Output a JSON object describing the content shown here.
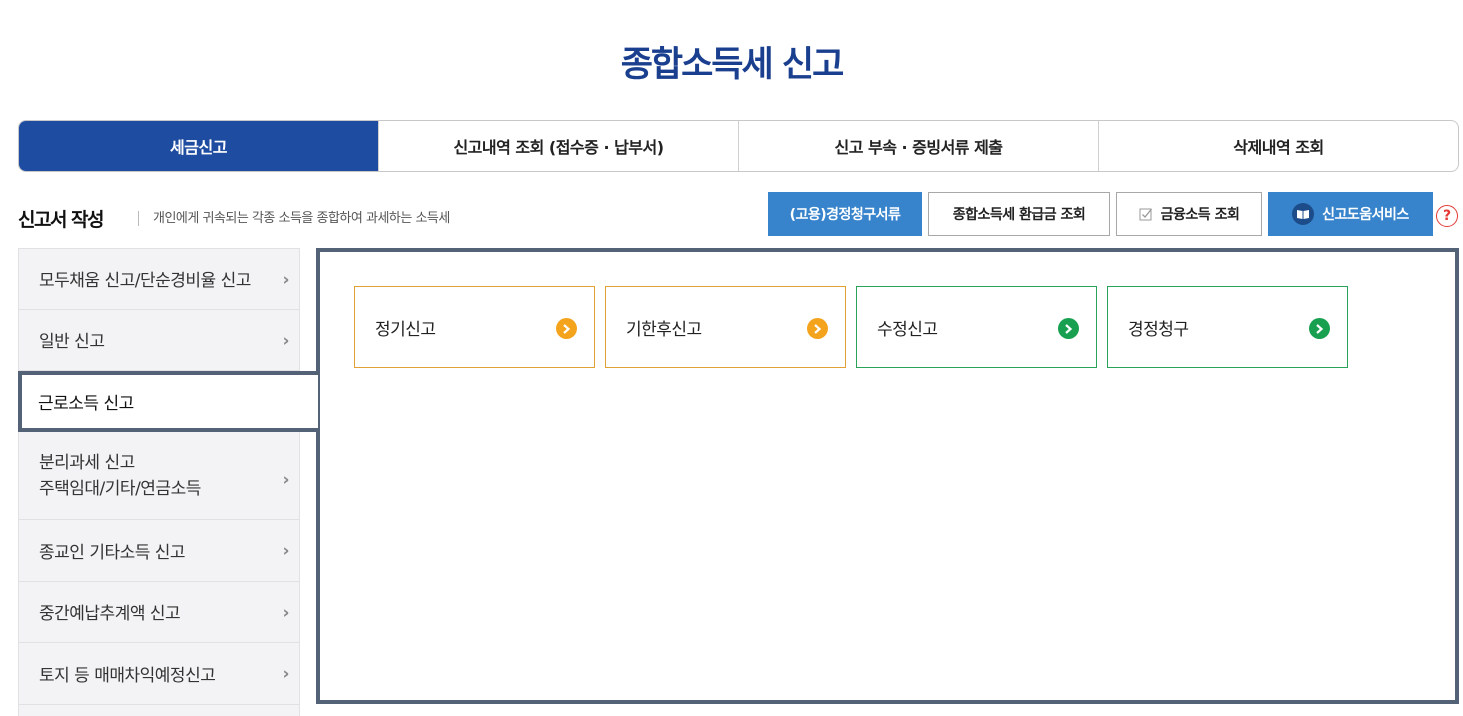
{
  "page": {
    "title": "종합소득세 신고"
  },
  "tabs": [
    {
      "label": "세금신고",
      "active": true
    },
    {
      "label": "신고내역 조회 (접수증 · 납부서)",
      "active": false
    },
    {
      "label": "신고 부속 · 증빙서류 제출",
      "active": false
    },
    {
      "label": "삭제내역 조회",
      "active": false
    }
  ],
  "section": {
    "title": "신고서 작성",
    "description": "개인에게 귀속되는 각종 소득을 종합하여 과세하는 소득세"
  },
  "actions": {
    "claim_docs": "(고용)경정청구서류",
    "refund_lookup": "종합소득세 환급금 조회",
    "financial_income": "금융소득 조회",
    "help_service": "신고도움서비스",
    "help_icon": "?"
  },
  "side_menu": [
    {
      "label": "모두채움 신고/단순경비율 신고",
      "active": false
    },
    {
      "label": "일반 신고",
      "active": false
    },
    {
      "label": "근로소득 신고",
      "active": true
    },
    {
      "label_line1": "분리과세 신고",
      "label_line2": "주택임대/기타/연금소득",
      "active": false
    },
    {
      "label": "종교인 기타소득 신고",
      "active": false
    },
    {
      "label": "중간예납추계액 신고",
      "active": false
    },
    {
      "label": "토지 등 매매차익예정신고",
      "active": false
    }
  ],
  "filing_types": [
    {
      "label": "정기신고",
      "accent": "#f4a31d",
      "icon": "arrow-right-circle-icon"
    },
    {
      "label": "기한후신고",
      "accent": "#f4a31d",
      "icon": "arrow-right-circle-icon"
    },
    {
      "label": "수정신고",
      "accent": "#18a050",
      "icon": "arrow-right-circle-icon"
    },
    {
      "label": "경정청구",
      "accent": "#18a050",
      "icon": "arrow-right-circle-icon"
    }
  ],
  "colors": {
    "primary": "#1d4ca0",
    "button_blue": "#3784cc",
    "panel_border": "#546277",
    "orange": "#f4a31d",
    "green": "#18a050",
    "help_red": "#e53935"
  }
}
